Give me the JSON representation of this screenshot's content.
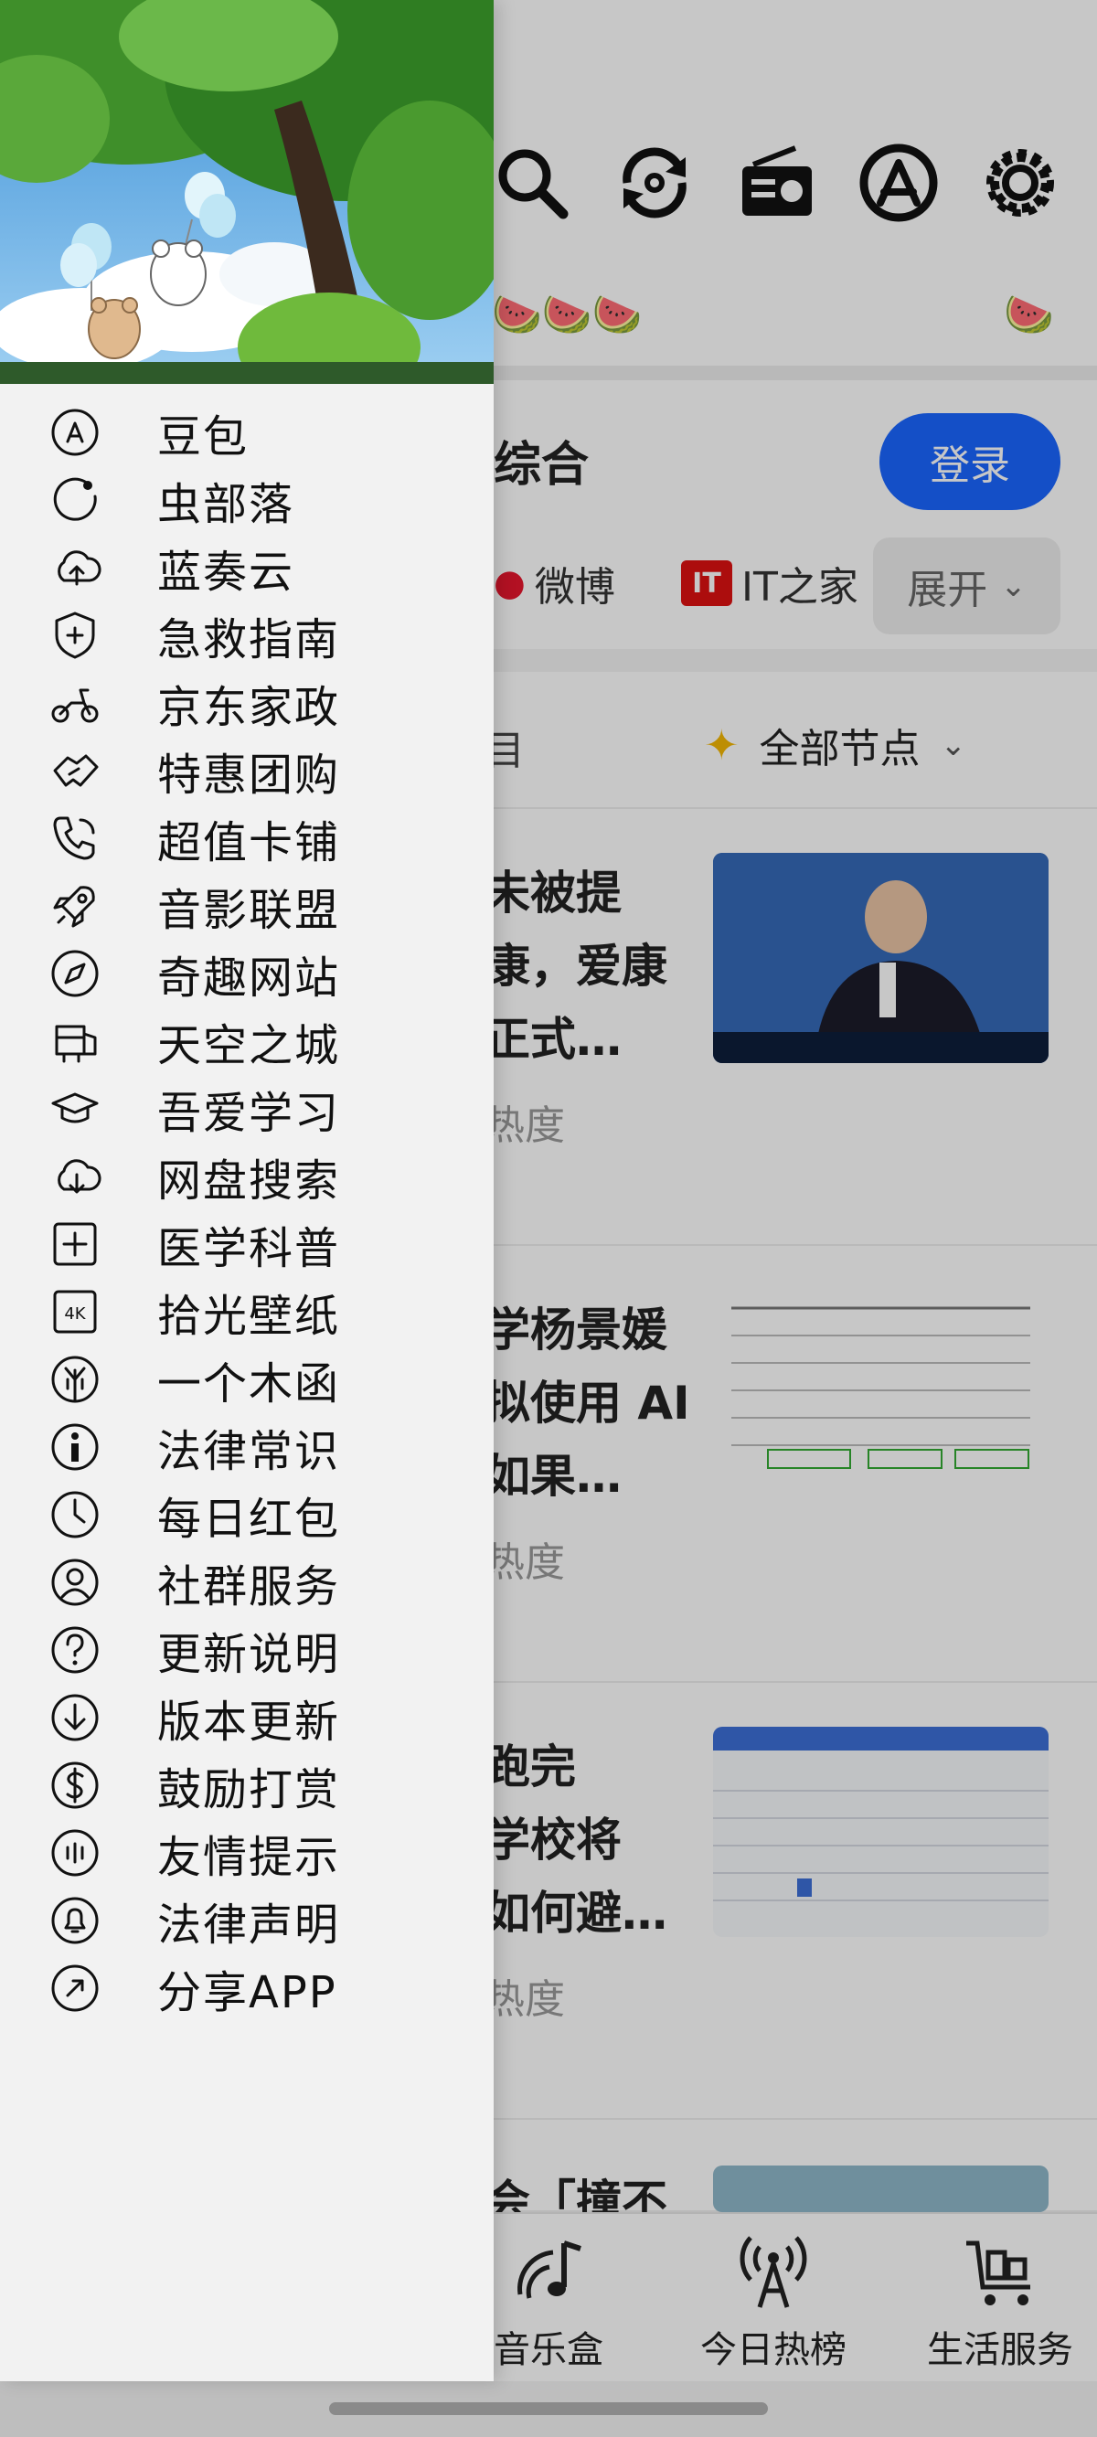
{
  "background_app": {
    "section_title": "综合",
    "login_label": "登录",
    "source_tabs": [
      "微博",
      "IT之家"
    ],
    "source_logo_text": "IT",
    "expand_label": "展开",
    "node_filter_label": "全部节点",
    "feed_head_partial": "目",
    "feed": [
      {
        "title": [
          "未被提",
          "康，爱康",
          "正式…"
        ],
        "heat": "热度"
      },
      {
        "title": [
          "学杨景媛",
          "拟使用 AI",
          "如果…"
        ],
        "heat": "热度"
      },
      {
        "title": [
          "跑完",
          "学校将",
          "如何避…"
        ],
        "heat": "热度"
      },
      {
        "title": [
          "会「撞不"
        ],
        "heat": ""
      }
    ],
    "bottom_nav": [
      {
        "label": "音乐盒",
        "icon": "music-box-icon"
      },
      {
        "label": "今日热榜",
        "icon": "broadcast-tower-icon"
      },
      {
        "label": "生活服务",
        "icon": "cart-icon"
      }
    ],
    "top_icons": [
      "search-icon",
      "refresh-icon",
      "radio-icon",
      "app-store-icon",
      "settings-icon"
    ]
  },
  "drawer": {
    "header_image": "tree-and-balloon-bears-illustration",
    "items": [
      {
        "label": "豆包",
        "icon": "doubao-icon"
      },
      {
        "label": "虫部落",
        "icon": "circle-dot-icon"
      },
      {
        "label": "蓝奏云",
        "icon": "cloud-upload-icon"
      },
      {
        "label": "急救指南",
        "icon": "shield-plus-icon"
      },
      {
        "label": "京东家政",
        "icon": "scooter-icon"
      },
      {
        "label": "特惠团购",
        "icon": "handshake-icon"
      },
      {
        "label": "超值卡铺",
        "icon": "phone-call-icon"
      },
      {
        "label": "音影联盟",
        "icon": "rocket-icon"
      },
      {
        "label": "奇趣网站",
        "icon": "compass-icon"
      },
      {
        "label": "天空之城",
        "icon": "school-bus-icon"
      },
      {
        "label": "吾爱学习",
        "icon": "graduation-cap-icon"
      },
      {
        "label": "网盘搜索",
        "icon": "cloud-download-icon"
      },
      {
        "label": "医学科普",
        "icon": "plus-square-icon"
      },
      {
        "label": "拾光壁纸",
        "icon": "4k-icon"
      },
      {
        "label": "一个木函",
        "icon": "tree-icon"
      },
      {
        "label": "法律常识",
        "icon": "person-info-icon"
      },
      {
        "label": "每日红包",
        "icon": "clock-icon"
      },
      {
        "label": "社群服务",
        "icon": "user-circle-icon"
      },
      {
        "label": "更新说明",
        "icon": "question-icon"
      },
      {
        "label": "版本更新",
        "icon": "download-arrow-icon"
      },
      {
        "label": "鼓励打赏",
        "icon": "dollar-icon"
      },
      {
        "label": "友情提示",
        "icon": "sound-wave-icon"
      },
      {
        "label": "法律声明",
        "icon": "bell-icon"
      },
      {
        "label": "分享APP",
        "icon": "share-arrow-icon"
      }
    ]
  },
  "colors": {
    "accent": "#1a66ff",
    "drawer_bg": "#f2f2f2",
    "text": "#111111"
  }
}
